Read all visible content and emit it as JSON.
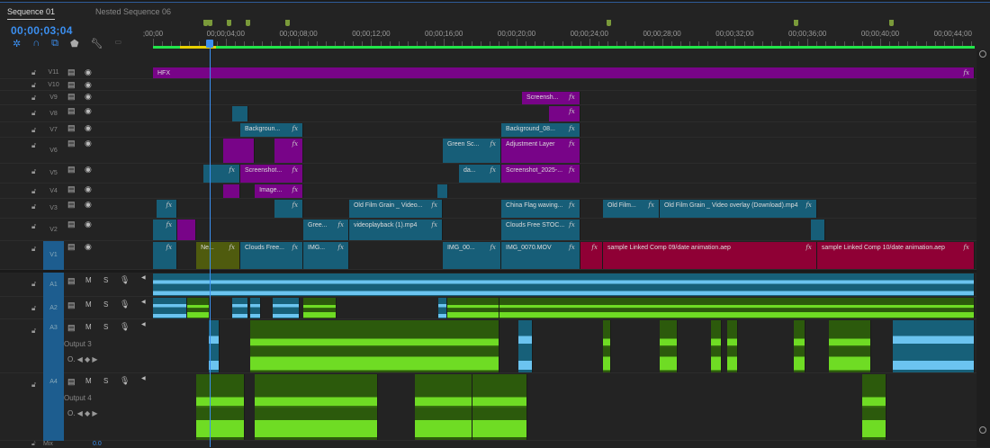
{
  "tabs": [
    {
      "label": "Sequence 01",
      "active": true
    },
    {
      "label": "Nested Sequence 06",
      "active": false
    }
  ],
  "timecode": "00;00;03;04",
  "playhead_seconds": 3.13,
  "tools": [
    "snap-icon",
    "magnet-icon",
    "linked-selection-icon",
    "marker-icon",
    "wrench-icon",
    "captions-icon"
  ],
  "ruler": {
    "labels": [
      ";00;00",
      "00;00;04;00",
      "00;00;08;00",
      "00;00;12;00",
      "00;00;16;00",
      "00;00;20;00",
      "00;00;24;00",
      "00;00;28;00",
      "00;00;32;00",
      "00;00;36;00",
      "00;00;40;00",
      "00;00;44;00"
    ],
    "label_seconds": [
      0,
      4,
      8,
      12,
      16,
      20,
      24,
      28,
      32,
      36,
      40,
      44
    ],
    "markers": [
      2.87,
      3.12,
      4.16,
      5.2,
      7.38,
      25.05,
      35.35,
      40.6
    ]
  },
  "video_tracks": [
    {
      "name": "V11",
      "clips": [
        {
          "s": 0,
          "e": 45.2,
          "c": "purple",
          "label": "HFX",
          "fx": true
        }
      ]
    },
    {
      "name": "V10",
      "clips": []
    },
    {
      "name": "V9",
      "clips": [
        {
          "s": 20.3,
          "e": 23.5,
          "c": "purple",
          "label": "Screensh...",
          "fx": true
        }
      ]
    },
    {
      "name": "V8",
      "clips": [
        {
          "s": 4.36,
          "e": 5.25,
          "c": "teal"
        },
        {
          "s": 21.8,
          "e": 23.5,
          "c": "purple",
          "fx": true
        }
      ]
    },
    {
      "name": "V7",
      "clips": [
        {
          "s": 4.8,
          "e": 8.27,
          "c": "teal",
          "label": "Backgroun...",
          "fx": true
        },
        {
          "s": 19.16,
          "e": 23.5,
          "c": "teal",
          "label": "Background_08...",
          "fx": true
        }
      ]
    },
    {
      "name": "V6",
      "clips": [
        {
          "s": 3.86,
          "e": 5.6,
          "c": "purple"
        },
        {
          "s": 6.68,
          "e": 8.27,
          "c": "purple",
          "fx": true
        },
        {
          "s": 15.94,
          "e": 19.16,
          "c": "teal",
          "label": "Green Sc...",
          "fx": true
        },
        {
          "s": 19.16,
          "e": 23.5,
          "c": "purple",
          "label": "Adjustment Layer",
          "fx": true
        }
      ]
    },
    {
      "name": "V5",
      "clips": [
        {
          "s": 2.77,
          "e": 4.8,
          "c": "teal",
          "fx": true
        },
        {
          "s": 4.8,
          "e": 8.27,
          "c": "purple",
          "label": "Screenshot...",
          "fx": true
        },
        {
          "s": 16.83,
          "e": 19.16,
          "c": "teal",
          "label": "da...",
          "fx": true
        },
        {
          "s": 19.16,
          "e": 23.5,
          "c": "purple",
          "label": "Screenshot_2025-...",
          "fx": true
        }
      ]
    },
    {
      "name": "V4",
      "clips": [
        {
          "s": 3.86,
          "e": 4.8,
          "c": "purple"
        },
        {
          "s": 5.6,
          "e": 8.27,
          "c": "purple",
          "label": "Image...",
          "fx": true
        },
        {
          "s": 15.64,
          "e": 16.24,
          "c": "teal"
        }
      ]
    },
    {
      "name": "V3",
      "clips": [
        {
          "s": 0.2,
          "e": 1.34,
          "c": "teal",
          "fx": true
        },
        {
          "s": 6.68,
          "e": 8.27,
          "c": "teal",
          "fx": true
        },
        {
          "s": 10.79,
          "e": 15.94,
          "c": "teal",
          "label": "Old Film Grain _ Video...",
          "fx": true
        },
        {
          "s": 19.16,
          "e": 23.5,
          "c": "teal",
          "label": "China Flag waving...",
          "fx": true
        },
        {
          "s": 24.75,
          "e": 27.87,
          "c": "teal",
          "label": "Old Film...",
          "fx": true
        },
        {
          "s": 27.87,
          "e": 36.53,
          "c": "teal",
          "label": "Old Film Grain _ Video overlay (Download).mp4",
          "fx": true
        }
      ]
    },
    {
      "name": "V2",
      "clips": [
        {
          "s": 0,
          "e": 1.34,
          "c": "teal",
          "fx": true
        },
        {
          "s": 1.34,
          "e": 2.38,
          "c": "purple"
        },
        {
          "s": 8.27,
          "e": 10.79,
          "c": "teal",
          "label": "Gree...",
          "fx": true
        },
        {
          "s": 10.79,
          "e": 15.94,
          "c": "teal",
          "label": "videoplayback (1).mp4",
          "fx": true
        },
        {
          "s": 19.16,
          "e": 23.5,
          "c": "teal",
          "label": "Clouds Free STOC...",
          "fx": true
        },
        {
          "s": 36.19,
          "e": 36.98,
          "c": "teal"
        }
      ]
    },
    {
      "name": "V1",
      "selected": true,
      "clips": [
        {
          "s": 0,
          "e": 1.34,
          "c": "teal",
          "fx": true
        },
        {
          "s": 2.38,
          "e": 4.8,
          "c": "olive",
          "label": "Ne...",
          "fx": true
        },
        {
          "s": 4.8,
          "e": 8.27,
          "c": "teal",
          "label": "Clouds Free...",
          "fx": true
        },
        {
          "s": 8.27,
          "e": 10.79,
          "c": "teal",
          "label": "IMG...",
          "fx": true
        },
        {
          "s": 15.94,
          "e": 19.16,
          "c": "teal",
          "label": "IMG_00...",
          "fx": true
        },
        {
          "s": 19.16,
          "e": 23.5,
          "c": "teal",
          "label": "IMG_0070.MOV",
          "fx": true
        },
        {
          "s": 23.5,
          "e": 24.75,
          "c": "red",
          "fx": true
        },
        {
          "s": 24.75,
          "e": 36.53,
          "c": "red",
          "label": "sample Linked Comp 09/date animation.aep",
          "fx": true
        },
        {
          "s": 36.53,
          "e": 45.2,
          "c": "red",
          "label": "sample Linked Comp 10/date animation.aep",
          "fx": true
        }
      ]
    }
  ],
  "audio_tracks": [
    {
      "name": "A1",
      "m": "M",
      "s": "S",
      "clips": [
        {
          "s": 0,
          "e": 45.2,
          "c": "ablue"
        }
      ]
    },
    {
      "name": "A2",
      "m": "M",
      "s": "S",
      "clips": [
        {
          "s": 0,
          "e": 1.9,
          "c": "ablue"
        },
        {
          "s": 1.9,
          "e": 3.1,
          "c": "agreen"
        },
        {
          "s": 4.36,
          "e": 5.25,
          "c": "ablue"
        },
        {
          "s": 5.35,
          "e": 5.94,
          "c": "ablue"
        },
        {
          "s": 6.6,
          "e": 8.07,
          "c": "ablue"
        },
        {
          "s": 8.27,
          "e": 10.1,
          "c": "agreen"
        },
        {
          "s": 15.7,
          "e": 16.2,
          "c": "ablue"
        },
        {
          "s": 16.2,
          "e": 19.06,
          "c": "agreen"
        },
        {
          "s": 19.06,
          "e": 45.2,
          "c": "agreen"
        }
      ]
    },
    {
      "name": "A3",
      "m": "M",
      "s": "S",
      "output": "Output 3",
      "clips": [
        {
          "s": 3.07,
          "e": 3.66,
          "c": "ablue"
        },
        {
          "s": 5.35,
          "e": 19.06,
          "c": "agreen"
        },
        {
          "s": 20.1,
          "e": 20.9,
          "c": "ablue"
        },
        {
          "s": 24.75,
          "e": 25.2,
          "c": "agreen"
        },
        {
          "s": 27.87,
          "e": 28.86,
          "c": "agreen"
        },
        {
          "s": 30.7,
          "e": 31.3,
          "c": "agreen"
        },
        {
          "s": 31.6,
          "e": 32.2,
          "c": "agreen"
        },
        {
          "s": 35.25,
          "e": 35.9,
          "c": "agreen"
        },
        {
          "s": 37.2,
          "e": 39.5,
          "c": "agreen"
        },
        {
          "s": 40.7,
          "e": 45.2,
          "c": "ablue"
        }
      ]
    },
    {
      "name": "A4",
      "m": "M",
      "s": "S",
      "output": "Output 4",
      "clips": [
        {
          "s": 2.38,
          "e": 5.05,
          "c": "agreen"
        },
        {
          "s": 5.6,
          "e": 12.38,
          "c": "agreen"
        },
        {
          "s": 14.4,
          "e": 17.57,
          "c": "agreen"
        },
        {
          "s": 17.57,
          "e": 20.6,
          "c": "agreen"
        },
        {
          "s": 39.0,
          "e": 40.35,
          "c": "agreen"
        }
      ]
    }
  ],
  "mix": {
    "label": "Mix",
    "value": "0.0"
  }
}
